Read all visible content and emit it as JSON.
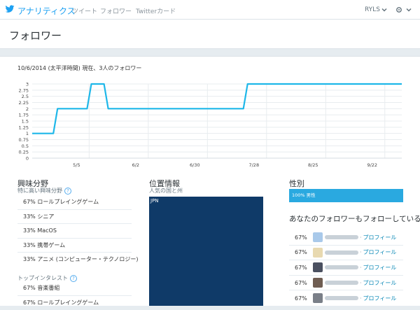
{
  "nav": {
    "brand": "アナリティクス",
    "links": [
      "ツイート",
      "フォロワー",
      "Twitterカード"
    ],
    "account": "RYLS"
  },
  "page": {
    "title": "フォロワー"
  },
  "chart_caption": "10/6/2014 (太平洋時間) 現在、3人のフォロワー",
  "chart_data": {
    "type": "line",
    "title": "",
    "xlabel": "",
    "ylabel": "",
    "x_ticks": [
      "5/5",
      "6/2",
      "6/30",
      "7/28",
      "8/25",
      "9/22"
    ],
    "y_ticks": [
      "0",
      "0.25",
      "0.5",
      "0.75",
      "1",
      "1.25",
      "1.5",
      "1.75",
      "2",
      "2.25",
      "2.5",
      "2.75",
      "3"
    ],
    "ylim": [
      0,
      3
    ],
    "xlim": [
      "2014-04-14",
      "2014-10-06"
    ],
    "grid": true,
    "line_color": "#1eb7e9",
    "series": [
      {
        "points": [
          [
            "2014-04-14",
            1
          ],
          [
            "2014-04-24",
            1
          ],
          [
            "2014-04-26",
            2
          ],
          [
            "2014-05-10",
            2
          ],
          [
            "2014-05-12",
            3
          ],
          [
            "2014-05-18",
            3
          ],
          [
            "2014-05-20",
            2
          ],
          [
            "2014-07-23",
            2
          ],
          [
            "2014-07-25",
            3
          ],
          [
            "2014-10-06",
            3
          ]
        ]
      }
    ]
  },
  "interests": {
    "title": "興味分野",
    "subtitle": "特に高い興味分野",
    "items": [
      {
        "pct": "67%",
        "label": "ロールプレイングゲーム"
      },
      {
        "pct": "33%",
        "label": "シニア"
      },
      {
        "pct": "33%",
        "label": "MacOS"
      },
      {
        "pct": "33%",
        "label": "携帯ゲーム"
      },
      {
        "pct": "33%",
        "label": "アニメ (コンピューター・テクノロジー)"
      }
    ],
    "top_title": "トップインタレスト",
    "top_items": [
      {
        "pct": "67%",
        "label": "音楽番組"
      },
      {
        "pct": "67%",
        "label": "ロールプレイングゲーム"
      }
    ]
  },
  "location": {
    "title": "位置情報",
    "subtitle": "人気の国と州",
    "region_label": "JPN"
  },
  "gender": {
    "title": "性別",
    "bar_label": "100% 男性",
    "value_pct": 100,
    "bar_color": "#2aa9e0"
  },
  "also_follow": {
    "title": "あなたのフォロワーもフォローしている",
    "items": [
      {
        "pct": "67%",
        "link": "プロフィール",
        "avatar_color": "#a9c9ea"
      },
      {
        "pct": "67%",
        "link": "プロフィール",
        "avatar_color": "#e8d9b0"
      },
      {
        "pct": "67%",
        "link": "プロフィール",
        "avatar_color": "#4a5060"
      },
      {
        "pct": "67%",
        "link": "プロフィール",
        "avatar_color": "#6f5d52"
      },
      {
        "pct": "67%",
        "link": "プロフィール",
        "avatar_color": "#7a7f88"
      }
    ]
  }
}
